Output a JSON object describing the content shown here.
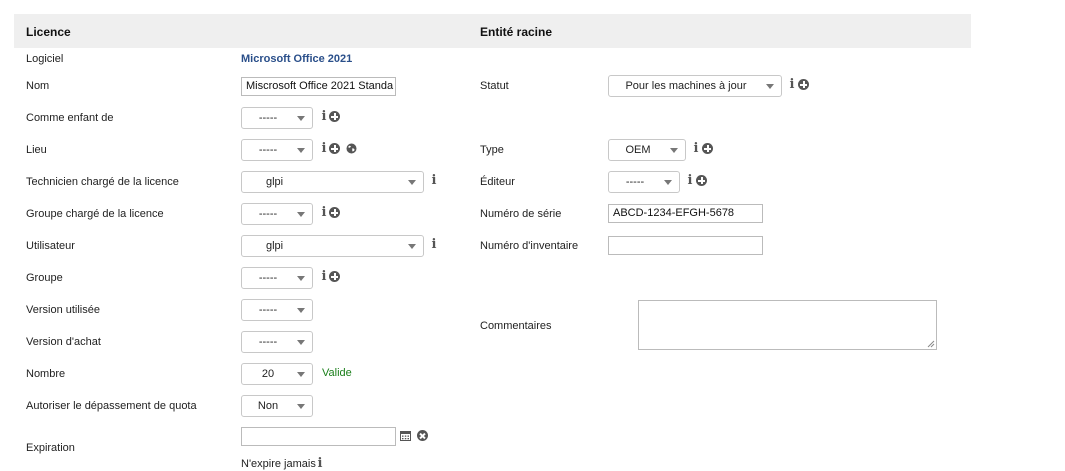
{
  "headers": {
    "left": "Licence",
    "right": "Entité racine"
  },
  "fields": {
    "logiciel": {
      "label": "Logiciel",
      "value": "Microsoft Office 2021"
    },
    "nom": {
      "label": "Nom",
      "value": "Miscrosoft Office 2021 Standa"
    },
    "comme_enfant": {
      "label": "Comme enfant de",
      "value": "-----"
    },
    "lieu": {
      "label": "Lieu",
      "value": "-----"
    },
    "technicien": {
      "label": "Technicien chargé de la licence",
      "value": "glpi"
    },
    "groupe_charge": {
      "label": "Groupe chargé de la licence",
      "value": "-----"
    },
    "utilisateur": {
      "label": "Utilisateur",
      "value": "glpi"
    },
    "groupe": {
      "label": "Groupe",
      "value": "-----"
    },
    "version_utilisee": {
      "label": "Version utilisée",
      "value": "-----"
    },
    "version_achat": {
      "label": "Version d'achat",
      "value": "-----"
    },
    "nombre": {
      "label": "Nombre",
      "value": "20",
      "status": "Valide"
    },
    "quota": {
      "label": "Autoriser le dépassement de quota",
      "value": "Non"
    },
    "expiration": {
      "label": "Expiration",
      "value": "",
      "note": "N'expire jamais"
    },
    "statut": {
      "label": "Statut",
      "value": "Pour les machines à jour"
    },
    "type": {
      "label": "Type",
      "value": "OEM"
    },
    "editeur": {
      "label": "Éditeur",
      "value": "-----"
    },
    "numero_serie": {
      "label": "Numéro de série",
      "value": "ABCD-1234-EFGH-5678"
    },
    "numero_inventaire": {
      "label": "Numéro d'inventaire",
      "value": ""
    },
    "commentaires": {
      "label": "Commentaires",
      "value": ""
    }
  },
  "icons": {
    "info": "info-icon",
    "add": "add-circle-icon",
    "globe": "globe-icon",
    "calendar": "calendar-icon",
    "clear": "clear-icon"
  },
  "colors": {
    "header_bg": "#efefef",
    "link": "#2a4f8a",
    "valid": "#1a7f1a",
    "icon": "#555555"
  }
}
